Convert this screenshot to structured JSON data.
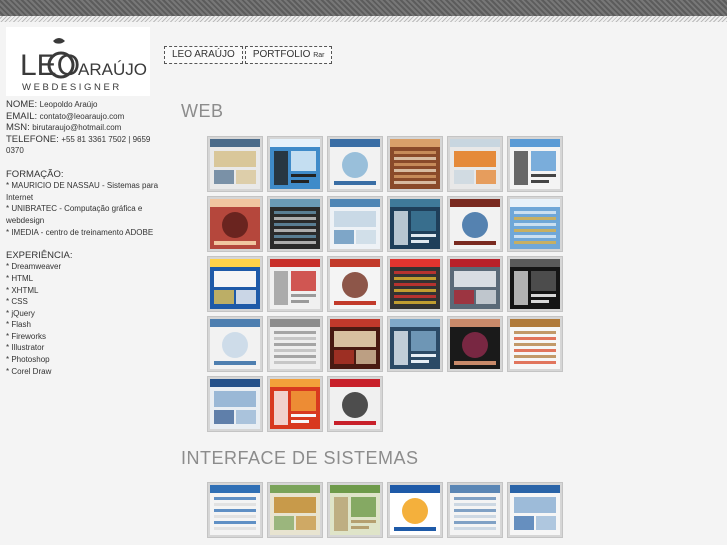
{
  "logo": {
    "text_main": "LEO",
    "text_surname": "ARAÚJO",
    "text_sub": "WEBDESIGNER"
  },
  "contact": [
    {
      "label": "NOME:",
      "value": "Leopoldo Araújo"
    },
    {
      "label": "EMAIL:",
      "value": "contato@leoaraujo.com"
    },
    {
      "label": "MSN:",
      "value": "birutaraujo@hotmail.com"
    },
    {
      "label": "TELEFONE:",
      "value": "+55 81 3361 7502 | 9659 0370"
    }
  ],
  "formacao": {
    "heading": "FORMAÇÃO:",
    "items": [
      "* MAURICIO DE NASSAU - Sistemas para Internet",
      "* UNIBRATEC - Computação gráfica e webdesign",
      "* IMEDIA - centro de treinamento ADOBE"
    ]
  },
  "experiencia": {
    "heading": "EXPERIÊNCIA:",
    "items": [
      "* Dreamweaver",
      "* HTML",
      "* XHTML",
      "* CSS",
      "* jQuery",
      "* Flash",
      "* Fireworks",
      "* Illustrator",
      "* Photoshop",
      "* Corel Draw"
    ]
  },
  "nav": {
    "home_label": "LEO ARAÚJO",
    "portfolio_label": "PORTFOLIO",
    "portfolio_suffix": "Rar"
  },
  "sections": [
    {
      "title": "WEB",
      "thumbs": [
        {
          "bg": "#e9e9e9",
          "accent": "#4a6b8a",
          "accent2": "#d9c79a"
        },
        {
          "bg": "#3f8bc9",
          "accent": "#e6f2fb",
          "accent2": "#222222"
        },
        {
          "bg": "#f2f2f2",
          "accent": "#3a6ea5",
          "accent2": "#8ab6d6"
        },
        {
          "bg": "#8a4a2a",
          "accent": "#d9a06a",
          "accent2": "#f0e0c8"
        },
        {
          "bg": "#e8e8e8",
          "accent": "#c8d6e0",
          "accent2": "#e58a3a"
        },
        {
          "bg": "#f4f4f4",
          "accent": "#5b9bd5",
          "accent2": "#444444"
        },
        {
          "bg": "#b5473c",
          "accent": "#f1c6a0",
          "accent2": "#5d1f1a"
        },
        {
          "bg": "#2a2a2a",
          "accent": "#6a9ab5",
          "accent2": "#d8d8d8"
        },
        {
          "bg": "#eef2f6",
          "accent": "#4f86b5",
          "accent2": "#c9d9e6"
        },
        {
          "bg": "#1f3f5a",
          "accent": "#3f7a9a",
          "accent2": "#dfe8ef"
        },
        {
          "bg": "#f2f2f2",
          "accent": "#7a2a20",
          "accent2": "#3a6ea5"
        },
        {
          "bg": "#6fa7d8",
          "accent": "#e8f2fa",
          "accent2": "#e3b23c"
        },
        {
          "bg": "#1e5aa8",
          "accent": "#ffd24a",
          "accent2": "#f5f5f5"
        },
        {
          "bg": "#f0f0f0",
          "accent": "#c8302a",
          "accent2": "#9a9a9a"
        },
        {
          "bg": "#f4f4f4",
          "accent": "#c23a2a",
          "accent2": "#7a3a2a"
        },
        {
          "bg": "#333333",
          "accent": "#e3342f",
          "accent2": "#f2c230"
        },
        {
          "bg": "#5a6a78",
          "accent": "#b8202a",
          "accent2": "#d8dde2"
        },
        {
          "bg": "#151515",
          "accent": "#5a5a5a",
          "accent2": "#d8d8d8"
        },
        {
          "bg": "#f2f2f2",
          "accent": "#4e7fb0",
          "accent2": "#c8d8e8"
        },
        {
          "bg": "#eeeeee",
          "accent": "#8c8c8c",
          "accent2": "#b8b8b8"
        },
        {
          "bg": "#4a1a12",
          "accent": "#c0392b",
          "accent2": "#d8c0a0"
        },
        {
          "bg": "#2b4a66",
          "accent": "#7fa9c9",
          "accent2": "#e6eef5"
        },
        {
          "bg": "#1a1a1a",
          "accent": "#c98a6a",
          "accent2": "#8a2a4a"
        },
        {
          "bg": "#f6f6f6",
          "accent": "#b07a3a",
          "accent2": "#d94a2a"
        },
        {
          "bg": "#e9eef3",
          "accent": "#23508a",
          "accent2": "#9ab8d6"
        },
        {
          "bg": "#d8391f",
          "accent": "#f3a13a",
          "accent2": "#f7f7f7"
        },
        {
          "bg": "#f0f0f0",
          "accent": "#c8202a",
          "accent2": "#303030"
        }
      ]
    },
    {
      "title": "INTERFACE DE SISTEMAS",
      "thumbs": [
        {
          "bg": "#f4f4f4",
          "accent": "#2f6fb5",
          "accent2": "#dcdcdc"
        },
        {
          "bg": "#e8e4d0",
          "accent": "#7aa35a",
          "accent2": "#c89a4a"
        },
        {
          "bg": "#dfe4c8",
          "accent": "#6e9a4a",
          "accent2": "#b5a070"
        },
        {
          "bg": "#ffffff",
          "accent": "#1e5aa8",
          "accent2": "#f2a21a"
        },
        {
          "bg": "#f4f4f4",
          "accent": "#5a86b5",
          "accent2": "#c0cfde"
        },
        {
          "bg": "#f6f6f6",
          "accent": "#2a64a8",
          "accent2": "#9dbbd9"
        }
      ]
    }
  ]
}
